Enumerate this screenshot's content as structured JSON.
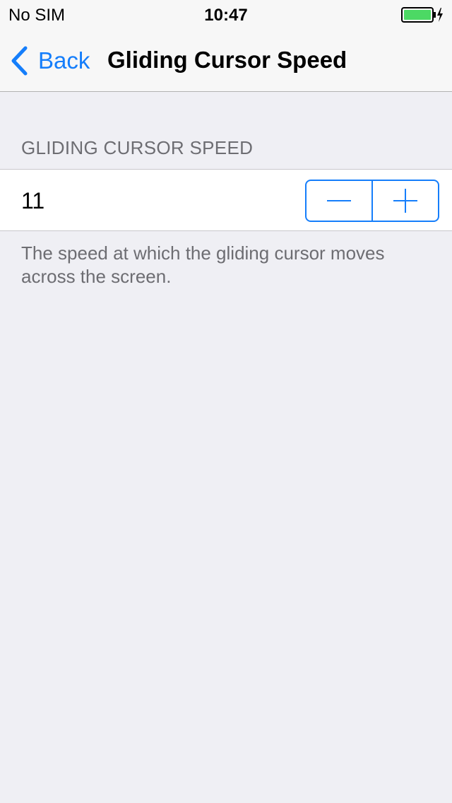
{
  "status_bar": {
    "carrier": "No SIM",
    "time": "10:47",
    "battery_color": "#4cd964"
  },
  "nav": {
    "back_label": "Back",
    "title": "Gliding Cursor Speed",
    "accent_color": "#157efb"
  },
  "section": {
    "header": "GLIDING CURSOR SPEED",
    "value": "11",
    "footer": "The speed at which the gliding cursor moves across the screen."
  },
  "icons": {
    "back": "chevron-left-icon",
    "decrement": "minus-icon",
    "increment": "plus-icon",
    "battery": "battery-charging-icon"
  }
}
